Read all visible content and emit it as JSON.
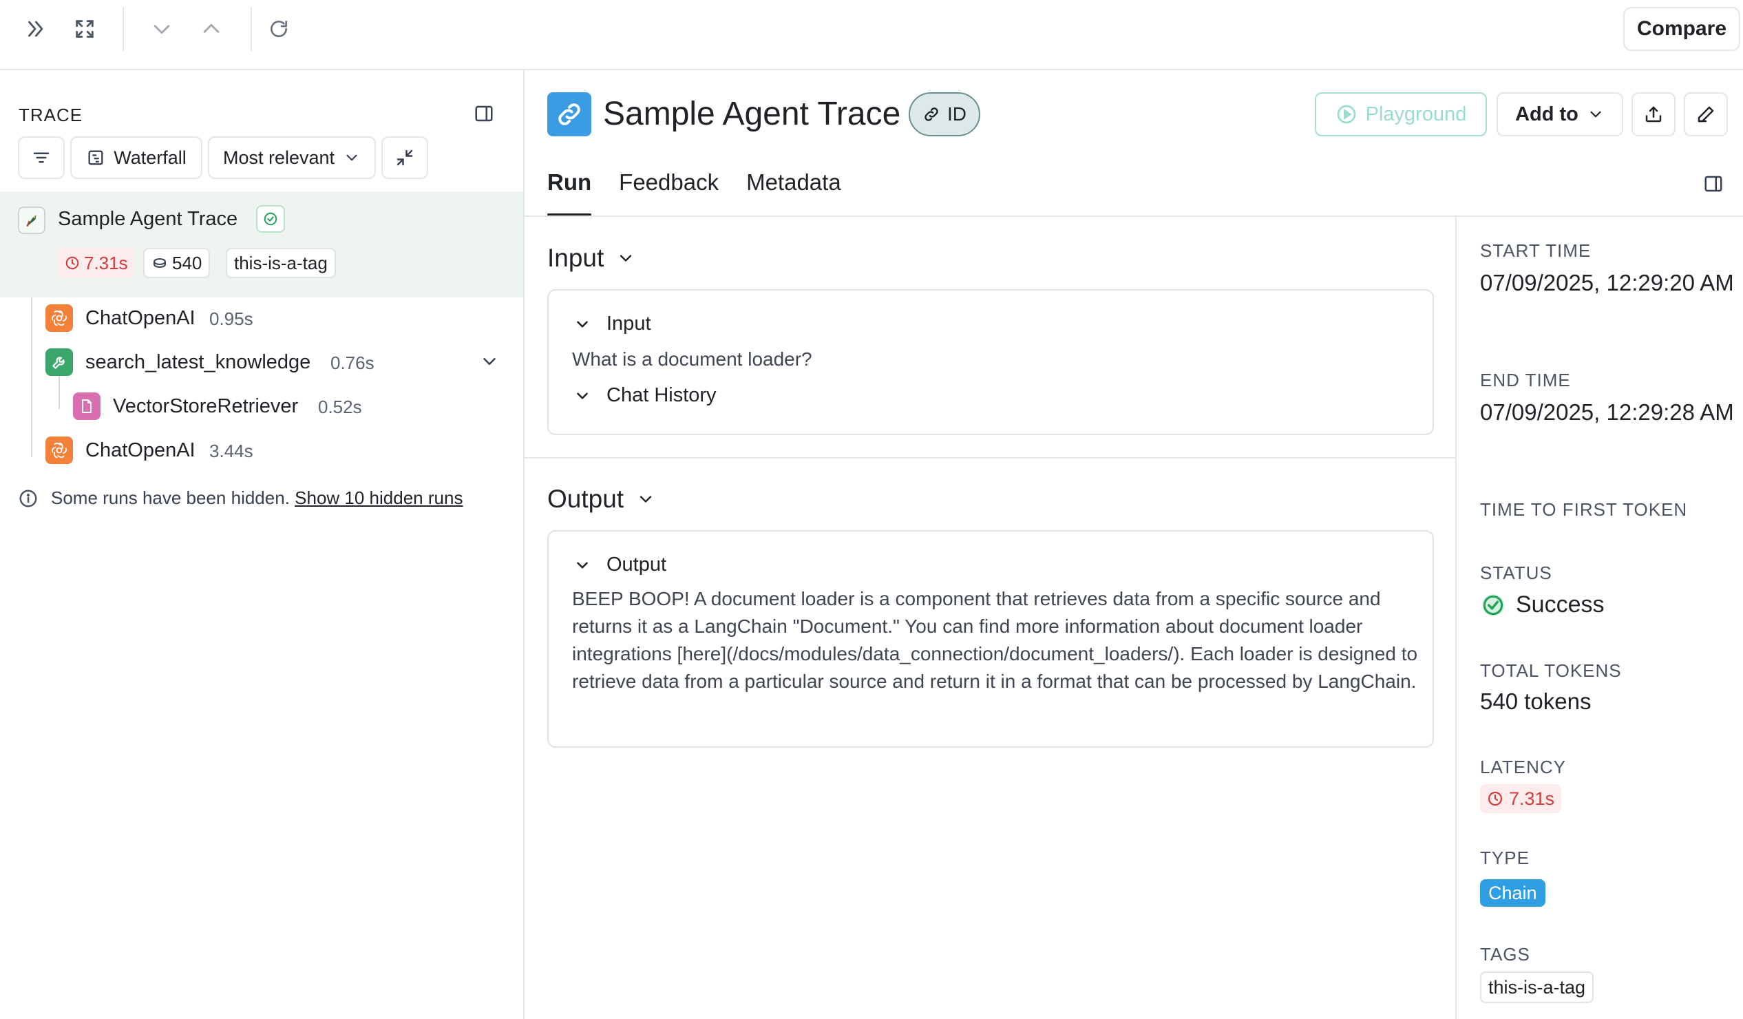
{
  "toolbar": {
    "compare_label": "Compare"
  },
  "left_panel": {
    "section_label": "TRACE",
    "waterfall_label": "Waterfall",
    "sort_label": "Most relevant",
    "root": {
      "name": "Sample Agent Trace",
      "latency": "7.31s",
      "tokens": "540",
      "tag": "this-is-a-tag"
    },
    "children": [
      {
        "name": "ChatOpenAI",
        "duration": "0.95s",
        "icon": "openai-icon"
      },
      {
        "name": "search_latest_knowledge",
        "duration": "0.76s",
        "icon": "wrench-icon"
      },
      {
        "name": "VectorStoreRetriever",
        "duration": "0.52s",
        "icon": "document-icon"
      },
      {
        "name": "ChatOpenAI",
        "duration": "3.44s",
        "icon": "openai-icon"
      }
    ],
    "hidden_note": "Some runs have been hidden.",
    "hidden_link": "Show 10 hidden runs"
  },
  "header": {
    "title": "Sample Agent Trace",
    "id_label": "ID",
    "playground_label": "Playground",
    "add_to_label": "Add to"
  },
  "tabs": [
    "Run",
    "Feedback",
    "Metadata"
  ],
  "input_section": {
    "title": "Input",
    "card_title": "Input",
    "value": "What is a document loader?",
    "chat_history_label": "Chat History"
  },
  "output_section": {
    "title": "Output",
    "card_title": "Output",
    "value": "BEEP BOOP! A document loader is a component that retrieves data from a specific source and returns it as a LangChain \"Document.\" You can find more information about document loader integrations [here](/docs/modules/data_connection/document_loaders/). Each loader is designed to retrieve data from a particular source and return it in a format that can be processed by LangChain."
  },
  "sidebar": {
    "start_time_label": "START TIME",
    "start_time": "07/09/2025, 12:29:20 AM",
    "end_time_label": "END TIME",
    "end_time": "07/09/2025, 12:29:28 AM",
    "ttft_label": "TIME TO FIRST TOKEN",
    "status_label": "STATUS",
    "status": "Success",
    "total_tokens_label": "TOTAL TOKENS",
    "total_tokens": "540 tokens",
    "latency_label": "LATENCY",
    "latency": "7.31s",
    "type_label": "TYPE",
    "type": "Chain",
    "tags_label": "TAGS",
    "tag": "this-is-a-tag"
  },
  "colors": {
    "accent_blue": "#3c9ce3",
    "openai_orange": "#f4803a",
    "tool_green": "#3aa66c",
    "retriever_pink": "#d96fb0",
    "success_green": "#22a35a",
    "latency_red": "#d43c3c"
  }
}
